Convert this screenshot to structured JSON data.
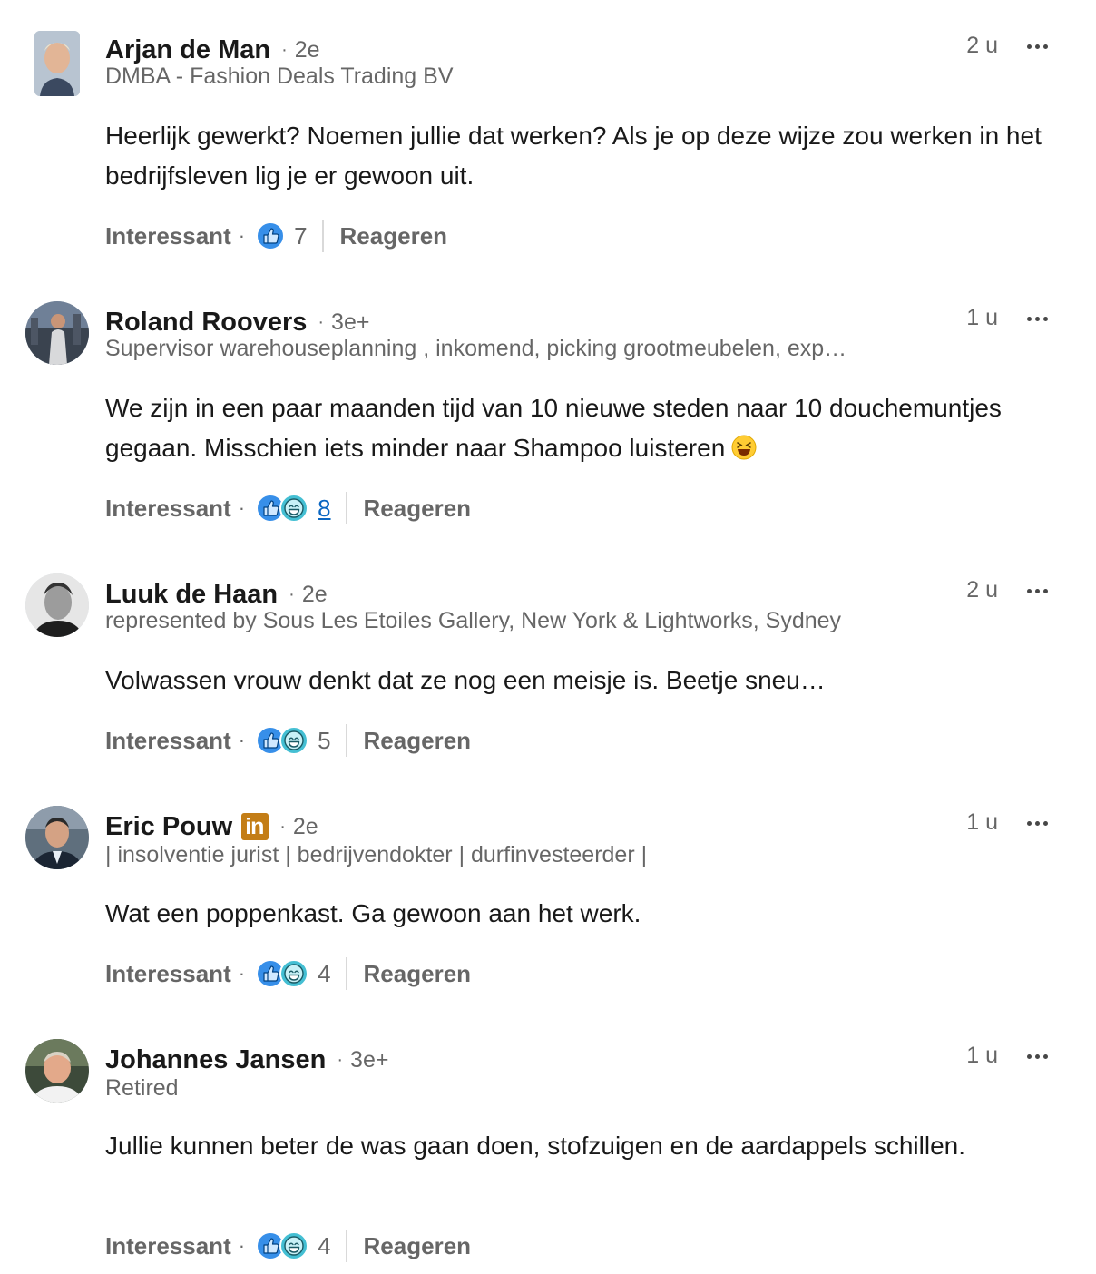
{
  "comments": [
    {
      "name": "Arjan de Man",
      "degree": "2e",
      "subtitle": "DMBA - Fashion Deals Trading BV",
      "time": "2 u",
      "text": "Heerlijk gewerkt? Noemen jullie dat werken? Als je op deze wijze zou werken in het bedrijfsleven lig je er gewoon uit.",
      "like_label": "Interessant",
      "reaction_count": "7",
      "reply_label": "Reageren"
    },
    {
      "name": "Roland Roovers",
      "degree": "3e+",
      "subtitle": "Supervisor warehouseplanning , inkomend, picking grootmeubelen, exp…",
      "time": "1 u",
      "text": "We zijn in een paar maanden tijd van 10 nieuwe steden naar 10 douchemuntjes gegaan. Misschien iets minder naar Shampoo luisteren",
      "like_label": "Interessant",
      "reaction_count": "8",
      "reply_label": "Reageren"
    },
    {
      "name": "Luuk de Haan",
      "degree": "2e",
      "subtitle": "represented by Sous Les Etoiles Gallery, New York & Lightworks, Sydney",
      "time": "2 u",
      "text": "Volwassen vrouw denkt dat ze nog een meisje is. Beetje sneu…",
      "like_label": "Interessant",
      "reaction_count": "5",
      "reply_label": "Reageren"
    },
    {
      "name": "Eric Pouw",
      "badge": "in",
      "degree": "2e",
      "subtitle": "| insolventie jurist | bedrijvendokter | durfinvesteerder |",
      "time": "1 u",
      "text": "Wat een poppenkast. Ga gewoon aan het werk.",
      "like_label": "Interessant",
      "reaction_count": "4",
      "reply_label": "Reageren"
    },
    {
      "name": "Johannes Jansen",
      "degree": "3e+",
      "subtitle": "Retired",
      "time": "1 u",
      "text": "Jullie kunnen beter de was gaan doen, stofzuigen en de aardappels schillen.",
      "like_label": "Interessant",
      "reaction_count": "4",
      "reply_label": "Reageren"
    }
  ],
  "separator_dot": "·",
  "icons": {
    "more": "more-horizontal-icon",
    "like": "like-reaction-icon",
    "funny": "funny-reaction-icon",
    "laugh_emoji": "laughing-emoji"
  },
  "colors": {
    "like_blue": "#378fe9",
    "funny_teal": "#44bfd3",
    "link_blue": "#0a66c2",
    "badge_gold": "#c37d16"
  }
}
